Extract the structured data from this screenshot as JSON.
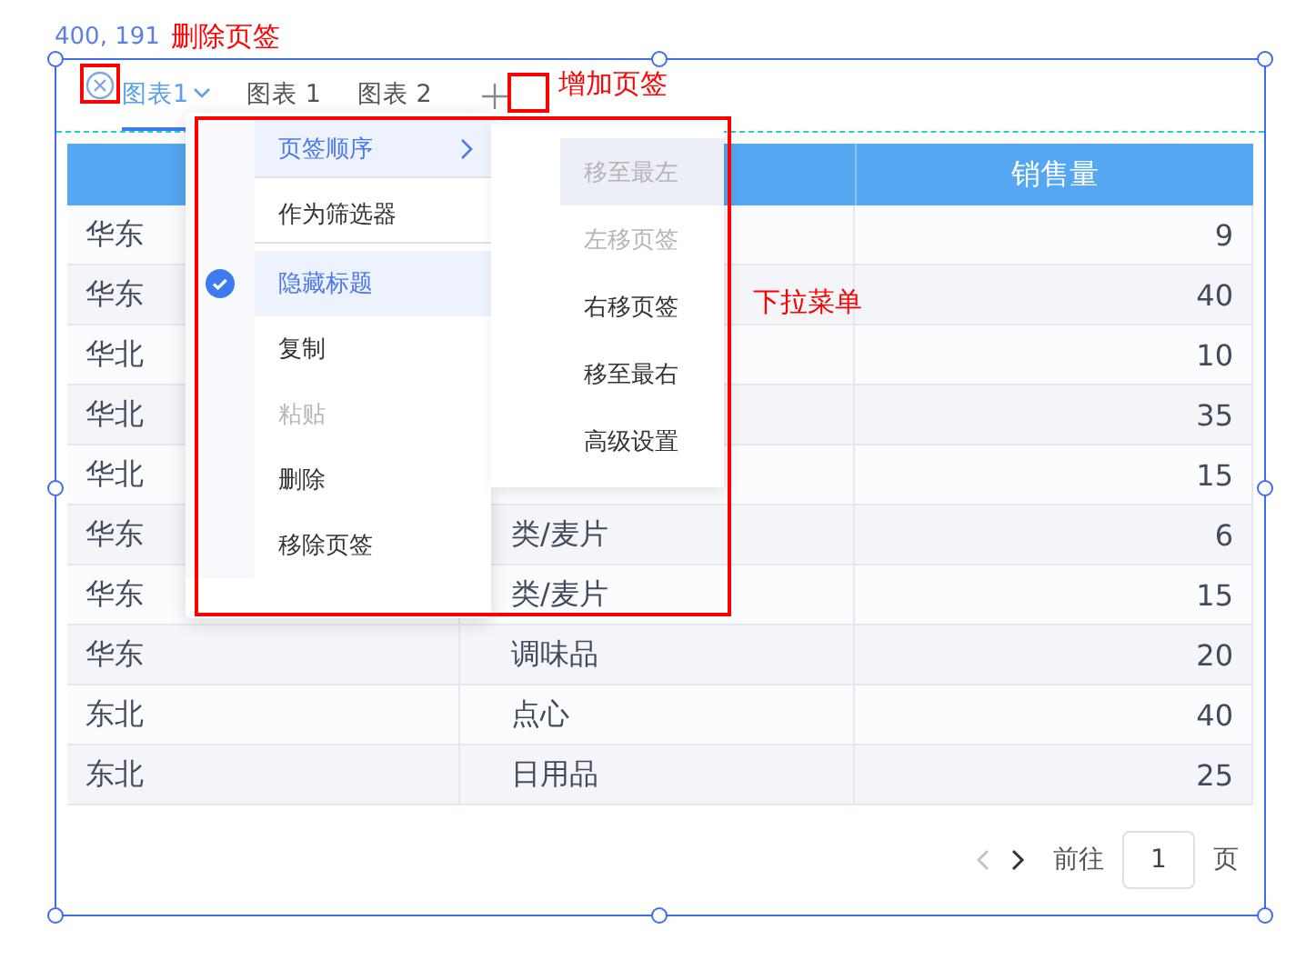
{
  "canvas_label": "400, 191",
  "annotations": [
    {
      "text": "删除页签",
      "kind": "delete"
    },
    {
      "text": "增加页签",
      "kind": "add"
    },
    {
      "text": "下拉菜单",
      "kind": "menu"
    }
  ],
  "tabs": [
    {
      "label": "图表1",
      "selected": true
    },
    {
      "label": "图表 1",
      "selected": false
    },
    {
      "label": "图表 2",
      "selected": false
    }
  ],
  "table": {
    "column_3": "销售量",
    "rows": [
      {
        "cells": [
          "华东",
          null,
          "9"
        ]
      },
      {
        "cells": [
          "华东",
          null,
          "40"
        ]
      },
      {
        "cells": [
          "华北",
          null,
          "10"
        ]
      },
      {
        "cells": [
          "华北",
          null,
          "35"
        ]
      },
      {
        "cells": [
          "华北",
          null,
          "15"
        ]
      },
      {
        "cells": [
          "华东",
          "类/麦片",
          "6"
        ]
      },
      {
        "cells": [
          "华东",
          "类/麦片",
          "15"
        ]
      },
      {
        "cells": [
          "华东",
          "调味品",
          "20"
        ]
      },
      {
        "cells": [
          "东北",
          "点心",
          "40"
        ]
      },
      {
        "cells": [
          "东北",
          "日用品",
          "25"
        ]
      }
    ]
  },
  "menu": {
    "items": [
      {
        "label": "页签顺序",
        "kind": "submenu",
        "highlighted": true,
        "checked": false,
        "disabled": false,
        "divider_after": true
      },
      {
        "label": "作为筛选器",
        "kind": "item",
        "highlighted": false,
        "checked": false,
        "disabled": false,
        "divider_after": true
      },
      {
        "label": "隐藏标题",
        "kind": "item",
        "highlighted": true,
        "checked": true,
        "disabled": false,
        "divider_after": false
      },
      {
        "label": "复制",
        "kind": "item",
        "highlighted": false,
        "checked": false,
        "disabled": false,
        "divider_after": false
      },
      {
        "label": "粘贴",
        "kind": "item",
        "highlighted": false,
        "checked": false,
        "disabled": true,
        "divider_after": false
      },
      {
        "label": "删除",
        "kind": "item",
        "highlighted": false,
        "checked": false,
        "disabled": false,
        "divider_after": false
      },
      {
        "label": "移除页签",
        "kind": "item",
        "highlighted": false,
        "checked": false,
        "disabled": false,
        "divider_after": false
      }
    ]
  },
  "submenu": {
    "items": [
      {
        "label": "移至最左",
        "highlighted": true,
        "disabled": true
      },
      {
        "label": "左移页签",
        "highlighted": false,
        "disabled": true
      },
      {
        "label": "右移页签",
        "highlighted": false,
        "disabled": false
      },
      {
        "label": "移至最右",
        "highlighted": false,
        "disabled": false
      },
      {
        "label": "高级设置",
        "highlighted": false,
        "disabled": false
      }
    ]
  },
  "pagination": {
    "prev_disabled": true,
    "next_disabled": false,
    "goto_label": "前往",
    "page": "1",
    "page_suffix": "页"
  }
}
